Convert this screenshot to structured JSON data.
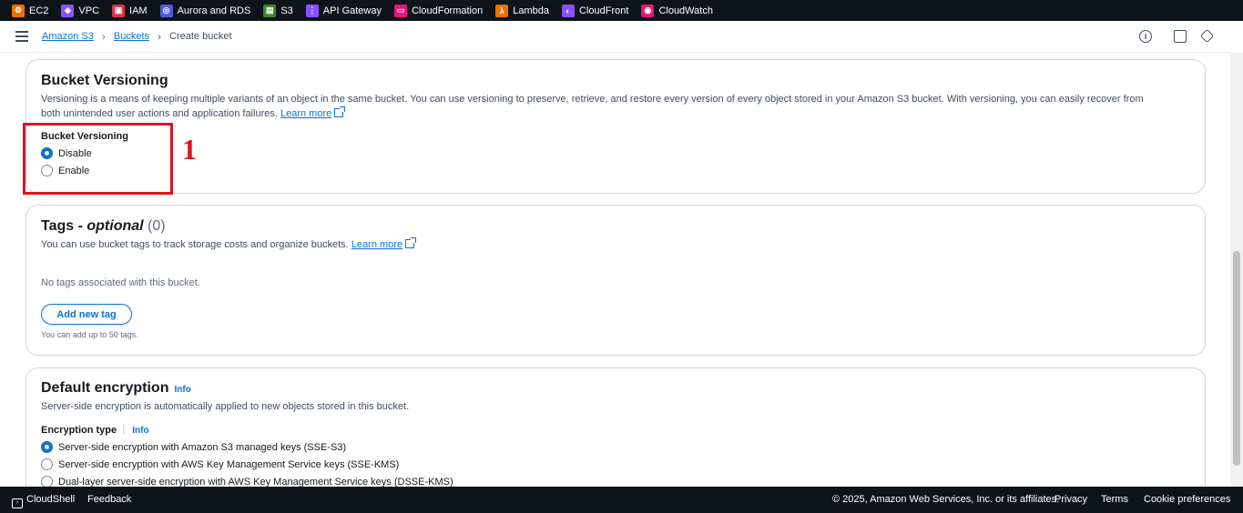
{
  "favorites": [
    {
      "label": "EC2",
      "icon": "ec2-icon",
      "color": "#ed7100"
    },
    {
      "label": "VPC",
      "icon": "vpc-icon",
      "color": "#8c4fff"
    },
    {
      "label": "IAM",
      "icon": "iam-icon",
      "color": "#dd344c"
    },
    {
      "label": "Aurora and RDS",
      "icon": "rds-icon",
      "color": "#4d5bd9"
    },
    {
      "label": "S3",
      "icon": "s3-icon",
      "color": "#3f8624"
    },
    {
      "label": "API Gateway",
      "icon": "api-gateway-icon",
      "color": "#8c4fff"
    },
    {
      "label": "CloudFormation",
      "icon": "cloudformation-icon",
      "color": "#e7157b"
    },
    {
      "label": "Lambda",
      "icon": "lambda-icon",
      "color": "#ed7100"
    },
    {
      "label": "CloudFront",
      "icon": "cloudfront-icon",
      "color": "#8c4fff"
    },
    {
      "label": "CloudWatch",
      "icon": "cloudwatch-icon",
      "color": "#e7157b"
    }
  ],
  "breadcrumb": {
    "home": "Amazon S3",
    "buckets": "Buckets",
    "current": "Create bucket"
  },
  "versioning": {
    "title": "Bucket Versioning",
    "description": "Versioning is a means of keeping multiple variants of an object in the same bucket. You can use versioning to preserve, retrieve, and restore every version of every object stored in your Amazon S3 bucket. With versioning, you can easily recover from",
    "description2": "both unintended user actions and application failures.",
    "learn_more": "Learn more",
    "field_label": "Bucket Versioning",
    "options": [
      "Disable",
      "Enable"
    ],
    "selected": "Disable"
  },
  "annotation": {
    "number": "1"
  },
  "tags": {
    "title": "Tags - ",
    "title_optional": "optional",
    "count": "(0)",
    "description": "You can use bucket tags to track storage costs and organize buckets.",
    "learn_more": "Learn more",
    "empty": "No tags associated with this bucket.",
    "add_button": "Add new tag",
    "hint": "You can add up to 50 tags."
  },
  "encryption": {
    "title": "Default encryption",
    "info": "Info",
    "description": "Server-side encryption is automatically applied to new objects stored in this bucket.",
    "type_label": "Encryption type",
    "type_info": "Info",
    "options": [
      "Server-side encryption with Amazon S3 managed keys (SSE-S3)",
      "Server-side encryption with AWS Key Management Service keys (SSE-KMS)",
      "Dual-layer server-side encryption with AWS Key Management Service keys (DSSE-KMS)"
    ],
    "selected": "Server-side encryption with Amazon S3 managed keys (SSE-S3)"
  },
  "footer": {
    "cloudshell": "CloudShell",
    "feedback": "Feedback",
    "copyright": "© 2025, Amazon Web Services, Inc. or its affiliates.",
    "privacy": "Privacy",
    "terms": "Terms",
    "cookies": "Cookie preferences"
  },
  "colors": {
    "accent": "#0972d3",
    "annotation": "#e0141e",
    "topbar": "#0f141a"
  }
}
